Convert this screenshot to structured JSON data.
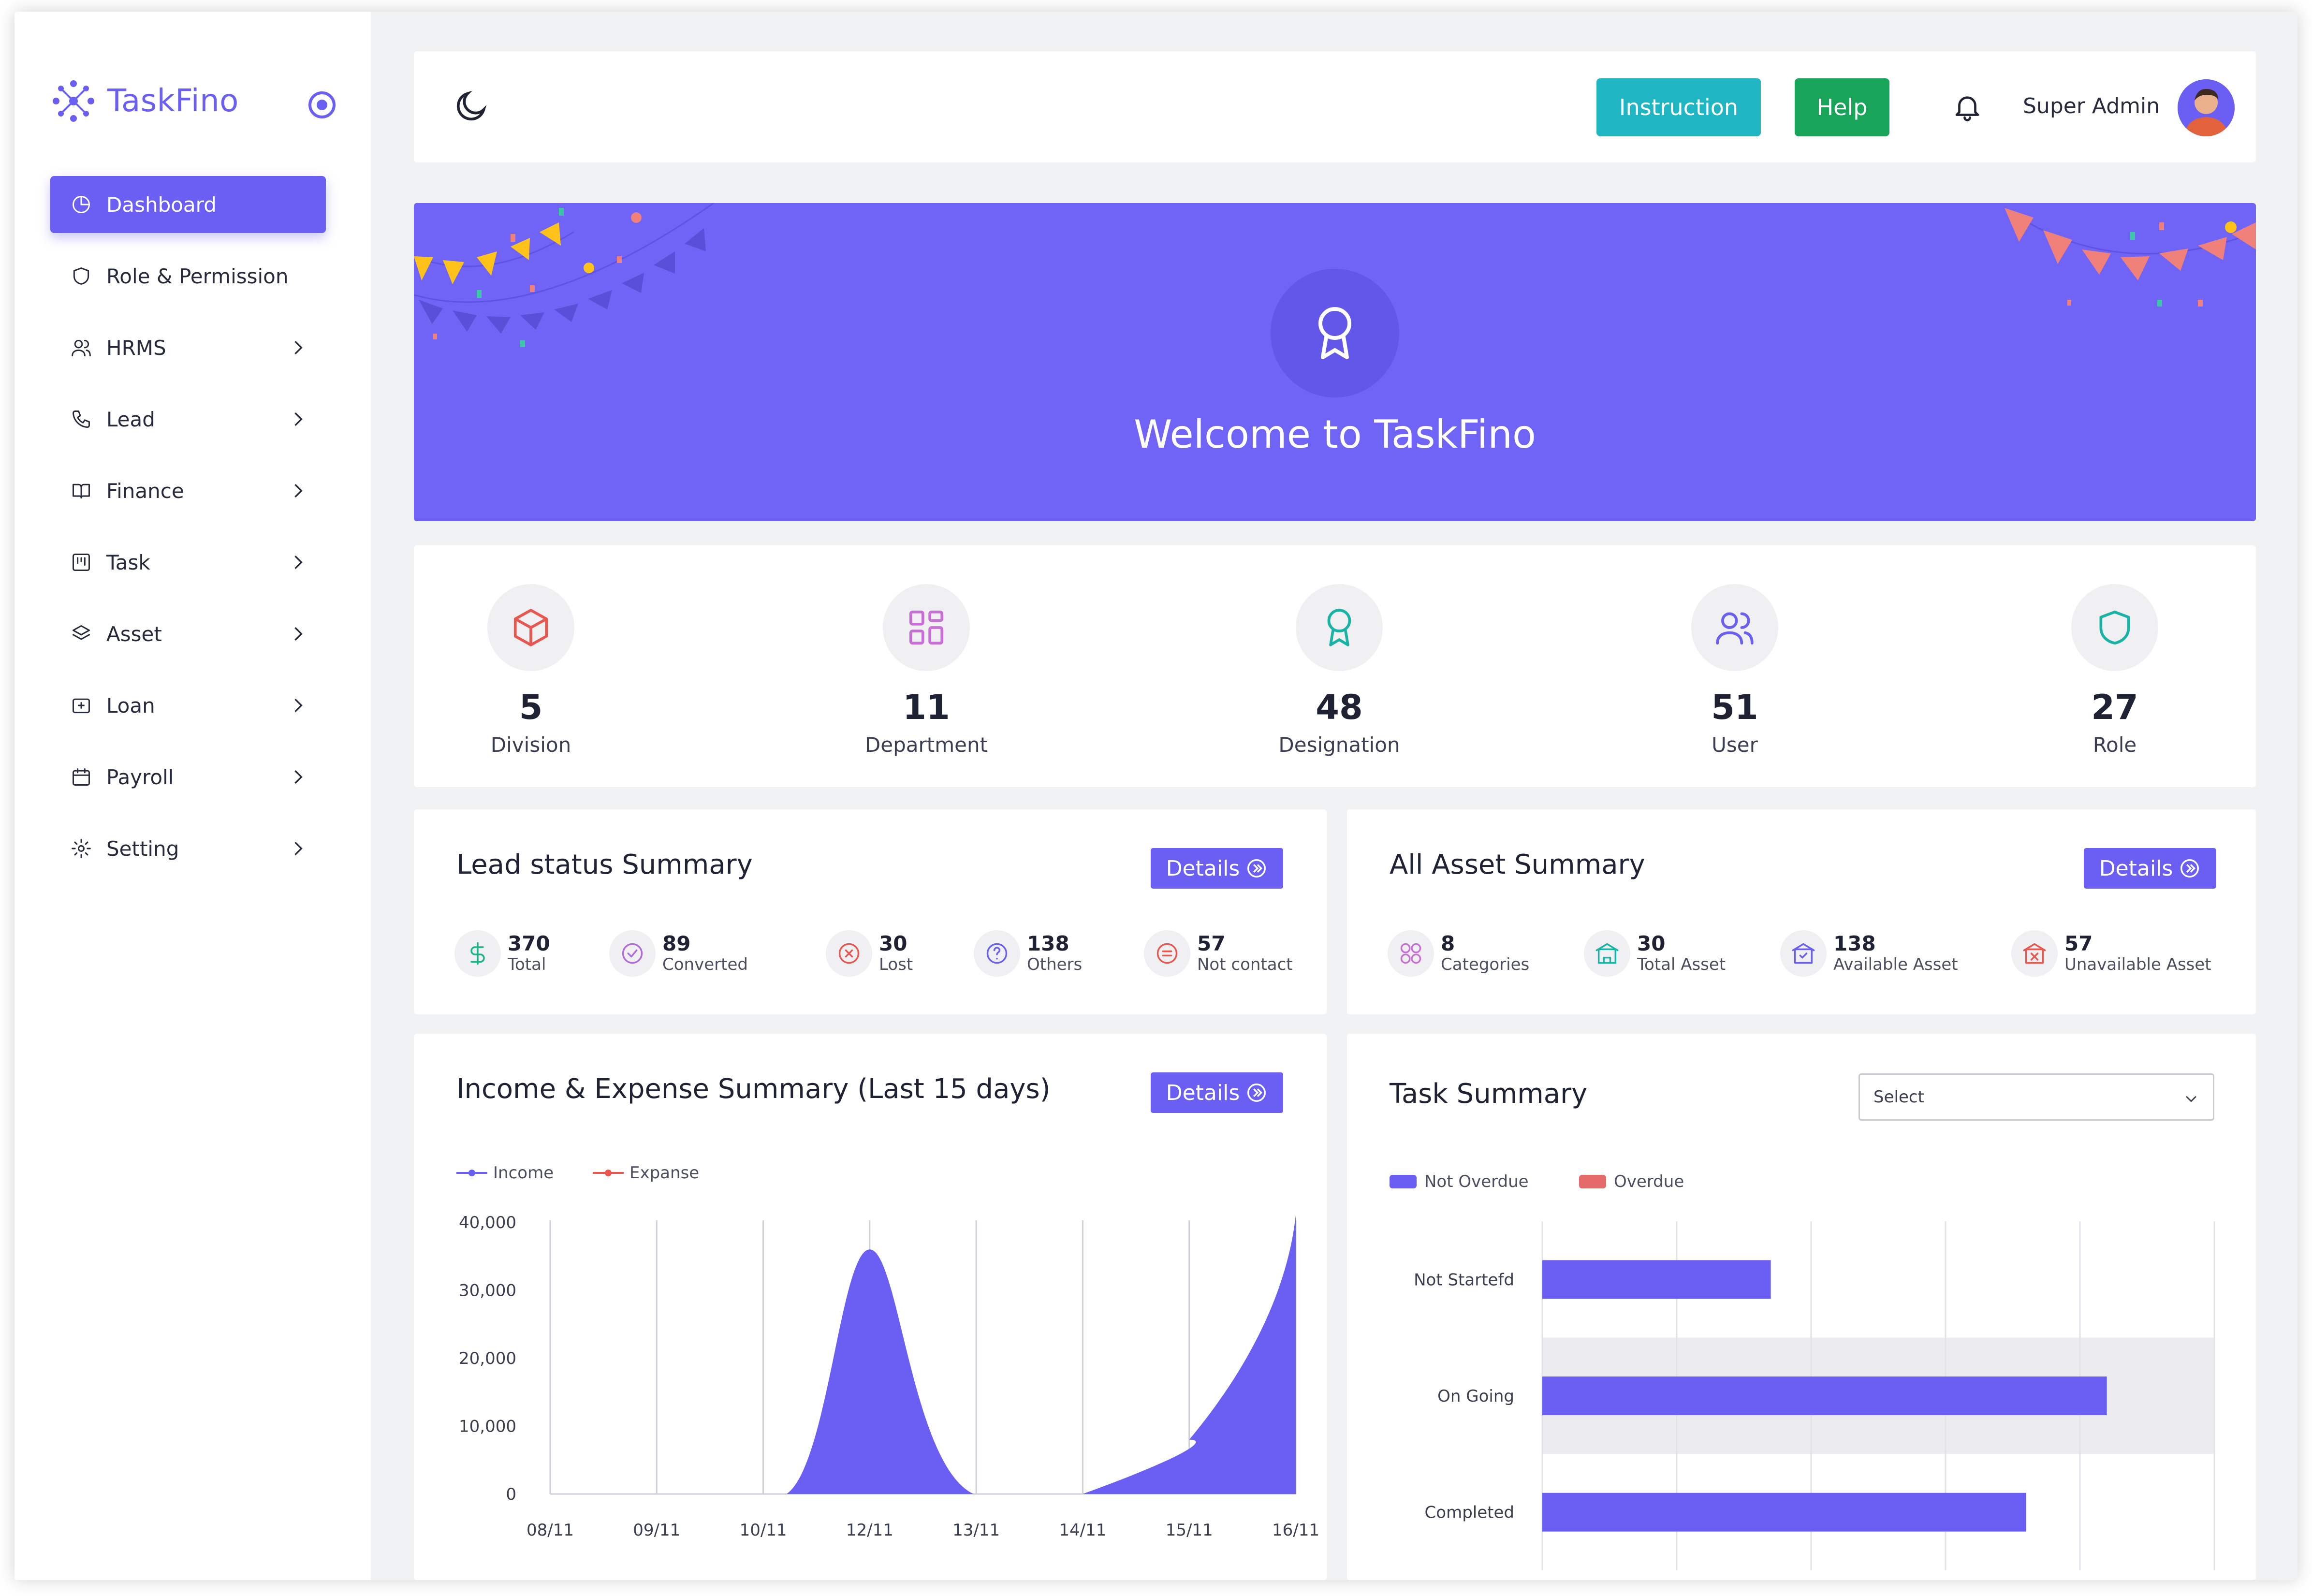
{
  "brand": {
    "name": "TaskFino"
  },
  "sidebar": {
    "items": [
      {
        "label": "Dashboard",
        "icon": "pie-chart-icon",
        "active": true,
        "chevron": false
      },
      {
        "label": "Role & Permission",
        "icon": "shield-icon",
        "active": false,
        "chevron": false
      },
      {
        "label": "HRMS",
        "icon": "users-icon",
        "active": false,
        "chevron": true
      },
      {
        "label": "Lead",
        "icon": "phone-icon",
        "active": false,
        "chevron": true
      },
      {
        "label": "Finance",
        "icon": "book-icon",
        "active": false,
        "chevron": true
      },
      {
        "label": "Task",
        "icon": "kanban-icon",
        "active": false,
        "chevron": true
      },
      {
        "label": "Asset",
        "icon": "layers-icon",
        "active": false,
        "chevron": true
      },
      {
        "label": "Loan",
        "icon": "wallet-icon",
        "active": false,
        "chevron": true
      },
      {
        "label": " Payroll",
        "icon": "calendar-icon",
        "active": false,
        "chevron": true
      },
      {
        "label": "Setting",
        "icon": "gear-icon",
        "active": false,
        "chevron": true
      }
    ]
  },
  "header": {
    "instruction_label": "Instruction",
    "help_label": "Help",
    "user_name": "Super Admin"
  },
  "banner": {
    "welcome": "Welcome to TaskFino"
  },
  "stats": [
    {
      "value": "5",
      "label": "Division",
      "icon": "box-icon",
      "color": "#e8574f"
    },
    {
      "value": "11",
      "label": "Department",
      "icon": "grid-icon",
      "color": "#c76fd6"
    },
    {
      "value": "48",
      "label": "Designation",
      "icon": "award-icon",
      "color": "#19b3a6"
    },
    {
      "value": "51",
      "label": "User",
      "icon": "users-icon",
      "color": "#6a5ff2"
    },
    {
      "value": "27",
      "label": "Role",
      "icon": "shield-icon",
      "color": "#19b3a6"
    }
  ],
  "lead_summary": {
    "title": "Lead status Summary",
    "details_label": "Details",
    "items": [
      {
        "value": "370",
        "label": "Total",
        "icon": "dollar-icon",
        "color": "#19b38a"
      },
      {
        "value": "89",
        "label": "Converted",
        "icon": "check-circle-icon",
        "color": "#b06be0"
      },
      {
        "value": "30",
        "label": "Lost",
        "icon": "x-circle-icon",
        "color": "#e8574f"
      },
      {
        "value": "138",
        "label": "Others",
        "icon": "question-icon",
        "color": "#6a5ff2"
      },
      {
        "value": "57",
        "label": "Not contact",
        "icon": "minus-circle-icon",
        "color": "#e8574f"
      }
    ]
  },
  "asset_summary": {
    "title": "All Asset Summary",
    "details_label": "Details",
    "items": [
      {
        "value": "8",
        "label": "Categories",
        "icon": "categories-icon",
        "color": "#c76fd6"
      },
      {
        "value": "30",
        "label": "Total Asset",
        "icon": "building-icon",
        "color": "#19b3a6"
      },
      {
        "value": "138",
        "label": "Available Asset",
        "icon": "building-check-icon",
        "color": "#6a5ff2"
      },
      {
        "value": "57",
        "label": "Unavailable Asset",
        "icon": "building-x-icon",
        "color": "#e8574f"
      }
    ]
  },
  "income_chart": {
    "title": "Income & Expense Summary (Last 15 days)",
    "details_label": "Details",
    "legend": [
      "Income",
      "Expanse"
    ]
  },
  "task_chart": {
    "title": "Task Summary",
    "select_label": "Select",
    "legend": [
      "Not Overdue",
      "Overdue"
    ]
  },
  "chart_data": [
    {
      "type": "area",
      "x": [
        "08/11",
        "09/11",
        "10/11",
        "12/11",
        "13/11",
        "14/11",
        "15/11",
        "16/11"
      ],
      "ylim": [
        0,
        40000
      ],
      "yticks": [
        "40,000",
        "30,000",
        "20,000",
        "10,000",
        "0"
      ],
      "series": [
        {
          "name": "Income",
          "color": "#6a5ff2",
          "values": [
            0,
            0,
            0,
            36000,
            0,
            0,
            8000,
            41000
          ]
        },
        {
          "name": "Expanse",
          "color": "#e8574f",
          "values": [
            0,
            0,
            0,
            0,
            0,
            0,
            0,
            0
          ]
        }
      ]
    },
    {
      "type": "bar",
      "orientation": "horizontal",
      "categories": [
        "Not Startefd",
        "On Going",
        "Completed"
      ],
      "series": [
        {
          "name": "Not Overdue",
          "color": "#6a5ff2",
          "values": [
            1.7,
            4.2,
            3.6
          ]
        },
        {
          "name": "Overdue",
          "color": "#e56a6a",
          "values": [
            0,
            0,
            0
          ]
        }
      ],
      "xlim": [
        0,
        5
      ]
    }
  ]
}
